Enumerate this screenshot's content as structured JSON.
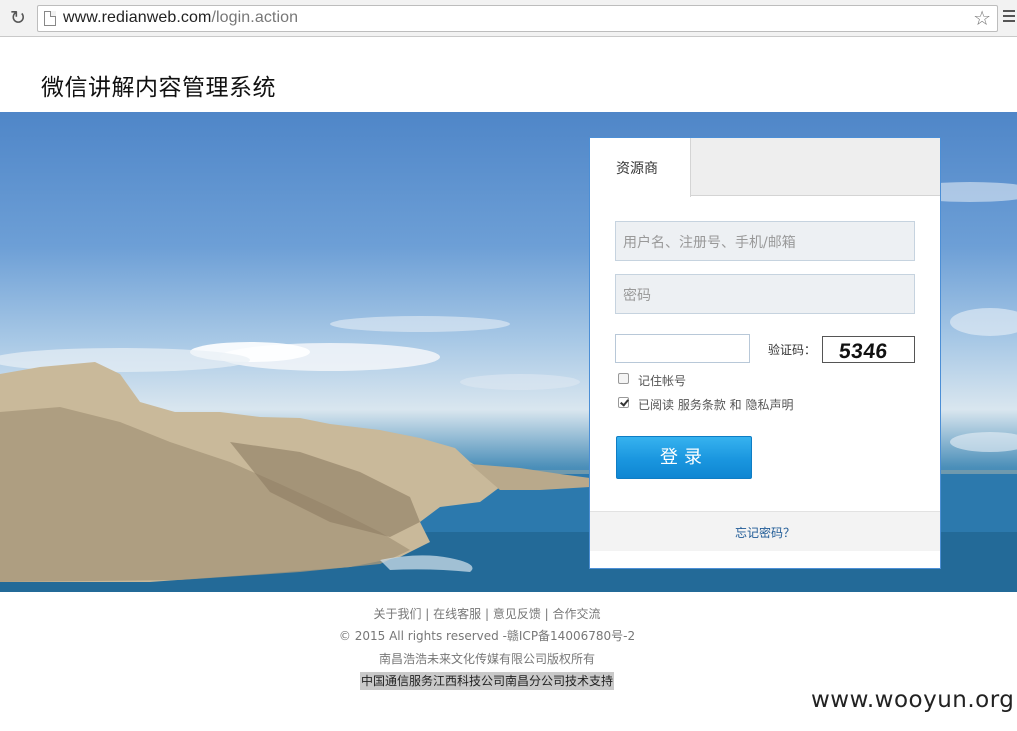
{
  "browser": {
    "url_host": "www.redianweb.com",
    "url_path": "/login.action",
    "icons": [
      "reload-icon",
      "page-icon",
      "star-icon",
      "menu-icon"
    ]
  },
  "header": {
    "title": "微信讲解内容管理系统"
  },
  "login": {
    "tab_label": "资源商",
    "username_placeholder": "用户名、注册号、手机/邮箱",
    "password_placeholder": "密码",
    "captcha_label": "验证码：",
    "captcha_code": "5346",
    "remember_label": "记住帐号",
    "remember_checked": false,
    "agree_label": "已阅读  服务条款  和  隐私声明",
    "agree_checked": true,
    "submit_label": "登录",
    "forgot_label": "忘记密码？"
  },
  "footer": {
    "links": "关于我们 | 在线客服 | 意见反馈 | 合作交流",
    "copyright": "© 2015 All rights reserved -赣ICP备14006780号-2",
    "company": "南昌浩浩未来文化传媒有限公司版权所有",
    "support": "中国通信服务江西科技公司南昌分公司技术支持"
  },
  "watermark": "www.wooyun.org",
  "colors": {
    "panel_border": "#4c8fd6",
    "button": "#1a96df",
    "link": "#1e5a96"
  }
}
